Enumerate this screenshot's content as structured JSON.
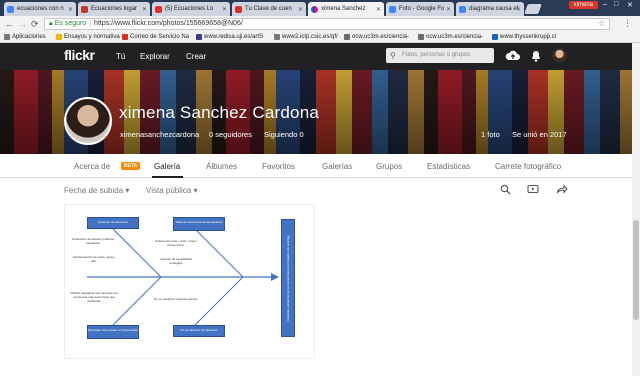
{
  "browser": {
    "tabs": [
      {
        "label": "ecuaciones con n",
        "color": "#4285f4"
      },
      {
        "label": "Ecuaciones logar",
        "color": "#c0392b"
      },
      {
        "label": "(5) Ecuaciones Lo",
        "color": "#e52d27"
      },
      {
        "label": "Tu Clave de cuen",
        "color": "#d93025"
      },
      {
        "label": "ximena Sanchez",
        "color": "#ff0084"
      },
      {
        "label": "Foto - Google Fo",
        "color": "#4285f4"
      },
      {
        "label": "diagrama causa ef",
        "color": "#4285f4"
      }
    ],
    "profile": "ximena",
    "secure_label": "Es seguro",
    "url": "https://www.flickr.com/photos/155669658@N06/",
    "bookmarks": [
      {
        "label": "Aplicaciones",
        "color": "#777777"
      },
      {
        "label": "Ensayos y normativa",
        "color": "#f4b400"
      },
      {
        "label": "Correo de Servicio Na",
        "color": "#d93025"
      },
      {
        "label": "www.redisa.uji.es/artS",
        "color": "#3b3b8f"
      },
      {
        "label": "www2.ictp.csic.es/qf/",
        "color": "#777777"
      },
      {
        "label": "ocw.uc3m.es/ciencia-",
        "color": "#6d6d6d"
      },
      {
        "label": "ocw.uc3m.es/ciencia-",
        "color": "#6d6d6d"
      },
      {
        "label": "www.thyssenkrupp.cl",
        "color": "#1565c0"
      }
    ]
  },
  "flickr": {
    "logo": "flickr",
    "nav": [
      "Tú",
      "Explorar",
      "Crear"
    ],
    "search_placeholder": "Fotos, personas o grupos"
  },
  "profile": {
    "name": "ximena Sanchez Cardona",
    "username": "ximenasanchezcardona",
    "followers": "0 seguidores",
    "following": "Siguiendo 0",
    "photos": "1 foto",
    "joined": "Se unió en 2017"
  },
  "tabs": [
    "Acerca de",
    "Galería",
    "Álbumes",
    "Favoritos",
    "Galerías",
    "Grupos",
    "Estadísticas",
    "Carrete fotográfico"
  ],
  "beta_label": "BETA",
  "filters": {
    "sort": "Fecha de subida",
    "view": "Vista pública"
  },
  "diagram": {
    "boxes": {
      "top_left": "Aumento de desechos",
      "top_right": "Falta de conciencia de los usuarios",
      "bottom_left": "Reciclaje muy escaso en temporadas",
      "bottom_right": "No se eliminan los plásticos",
      "head": "Desastre ambiental por la contaminación en plástico de reciclaje"
    },
    "causes": {
      "c1": "Ocupación de espacio (rellenos sanitarios)",
      "c2": "Contaminación de suelo, agua y aire.",
      "c3": "Cultura del \"usar y tirar\", mayor consumismo.",
      "c4": "Carecer de sensibilidad ecológica",
      "c5": "Modelo capitalista que fomenta una conciencia más económica que ambiental.",
      "c6": "No se reutilizan materias primas."
    }
  },
  "colors": {
    "accent": "#ff0084",
    "beta": "#ff8a00",
    "diagram_box": "#4472c4",
    "nav_bg": "#212124"
  }
}
